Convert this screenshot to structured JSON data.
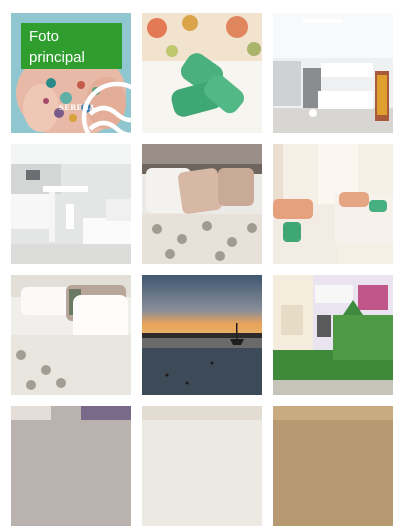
{
  "gallery": {
    "main_photo_label_line1": "Foto",
    "main_photo_label_line2": "principal",
    "logo_text": "SERENA",
    "photos": [
      {
        "icon": "hand-with-shells-photo"
      },
      {
        "icon": "folded-towels-photo"
      },
      {
        "icon": "kitchen-photo"
      },
      {
        "icon": "living-room-photo"
      },
      {
        "icon": "bed-with-pillows-photo"
      },
      {
        "icon": "bedroom-with-towel-photo"
      },
      {
        "icon": "bedroom-photo"
      },
      {
        "icon": "sunset-beach-photo"
      },
      {
        "icon": "building-exterior-photo"
      },
      {
        "icon": "partial-photo"
      },
      {
        "icon": "partial-photo"
      },
      {
        "icon": "partial-photo"
      }
    ]
  },
  "colors": {
    "badge": "#2f9e2f"
  }
}
